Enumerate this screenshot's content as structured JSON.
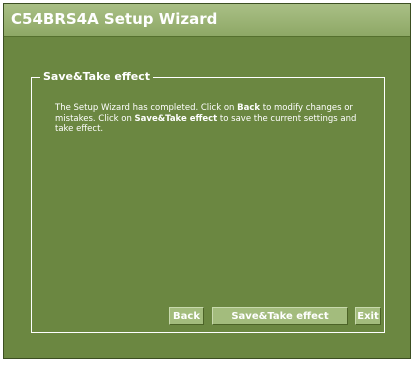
{
  "window": {
    "title": "C54BRS4A Setup Wizard"
  },
  "section": {
    "legend": "Save&Take effect",
    "message": {
      "part1": "The Setup Wizard has completed. Click on ",
      "back_word": "Back",
      "part2": " to modify changes or mistakes. Click on ",
      "save_word": "Save&Take effect",
      "part3": " to save the current settings and take effect."
    }
  },
  "buttons": {
    "back": "Back",
    "save": "Save&Take effect",
    "exit": "Exit"
  },
  "colors": {
    "background": "#6b8741",
    "titlebar": "#9cb574",
    "button": "#a3bc7d",
    "text": "#ffffff"
  }
}
